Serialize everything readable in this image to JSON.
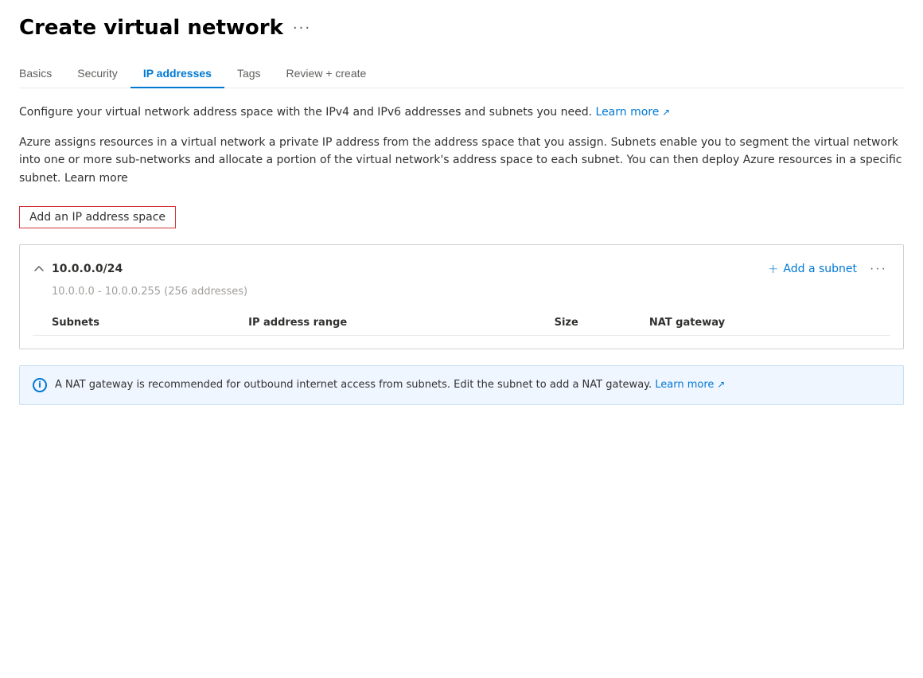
{
  "header": {
    "title": "Create virtual network",
    "more_icon": "···"
  },
  "tabs": [
    {
      "id": "basics",
      "label": "Basics",
      "active": false
    },
    {
      "id": "security",
      "label": "Security",
      "active": false
    },
    {
      "id": "ip-addresses",
      "label": "IP addresses",
      "active": true
    },
    {
      "id": "tags",
      "label": "Tags",
      "active": false
    },
    {
      "id": "review-create",
      "label": "Review + create",
      "active": false
    }
  ],
  "description1": "Configure your virtual network address space with the IPv4 and IPv6 addresses and subnets you need.",
  "description1_link": "Learn more",
  "description2": "Azure assigns resources in a virtual network a private IP address from the address space that you assign. Subnets enable you to segment the virtual network into one or more sub-networks and allocate a portion of the virtual network's address space to each subnet. You can then deploy Azure resources in a specific subnet.",
  "description2_link": "Learn more",
  "add_ip_button": "Add an IP address space",
  "ip_space": {
    "cidr": "10.0.0.0/24",
    "range": "10.0.0.0 - 10.0.0.255 (256 addresses)",
    "add_subnet_label": "Add a subnet",
    "more_options": "···",
    "table": {
      "columns": [
        "Subnets",
        "IP address range",
        "Size",
        "NAT gateway"
      ],
      "rows": []
    }
  },
  "info_banner": {
    "text": "A NAT gateway is recommended for outbound internet access from subnets. Edit the subnet to add a NAT gateway.",
    "link_text": "Learn more"
  }
}
